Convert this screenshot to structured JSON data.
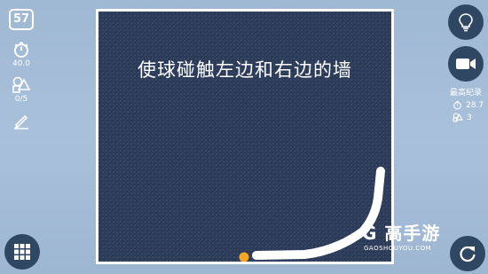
{
  "level": "57",
  "stats": {
    "timer_value": "40.0",
    "shapes_value": "0/5"
  },
  "board": {
    "instruction": "使球碰触左边和右边的墙"
  },
  "best_record": {
    "title": "最高纪录",
    "time": "28.7",
    "shapes": "3"
  },
  "watermark": {
    "brand": "G 高手游",
    "url": "GAOSHOUYOU.COM"
  },
  "colors": {
    "board_bg": "#2a3a59",
    "ball": "#f5a623",
    "stroke": "#ffffff",
    "button_bg": "#2f4762"
  },
  "icons": [
    "stopwatch-icon",
    "shapes-icon",
    "pencil-icon",
    "lightbulb-icon",
    "video-camera-icon",
    "grid-menu-icon",
    "restart-icon"
  ]
}
